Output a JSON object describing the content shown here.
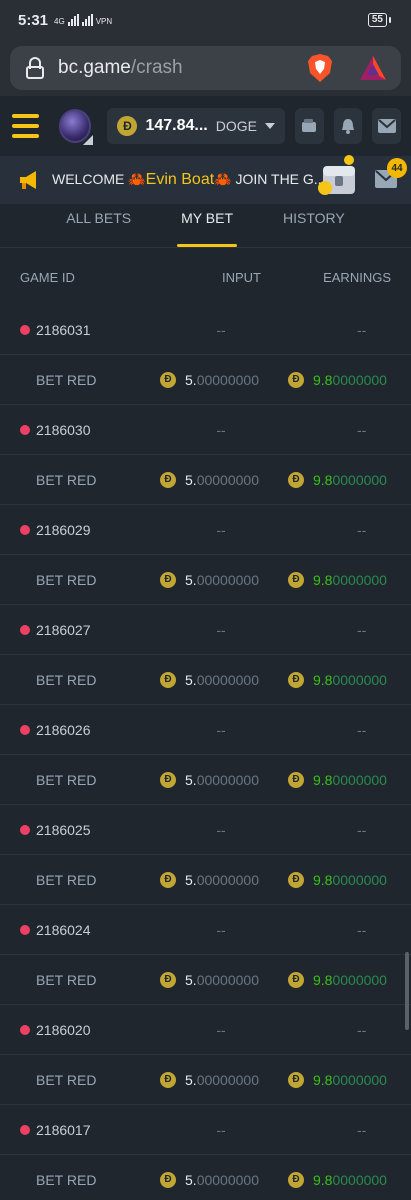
{
  "status": {
    "time": "5:31",
    "battery": "55",
    "net_labels": [
      "4G",
      "VPN"
    ]
  },
  "browser": {
    "domain": "bc.game",
    "path": "/crash"
  },
  "header": {
    "balance": "147.84...",
    "currency": "DOGE"
  },
  "ticker": {
    "prefix": "WELCOME",
    "name": "Evin Boat",
    "suffix": "JOIN THE G...",
    "crab": "🦀",
    "mail_badge": "44"
  },
  "tabs": [
    {
      "label": "ALL BETS",
      "active": false
    },
    {
      "label": "MY BET",
      "active": true
    },
    {
      "label": "HISTORY",
      "active": false
    }
  ],
  "table": {
    "headers": {
      "game_id": "GAME ID",
      "input": "INPUT",
      "earnings": "EARNINGS"
    },
    "placeholder": "--",
    "bet_label": "BET RED",
    "input_whole": "5.",
    "input_frac": "00000000",
    "earn_whole": "9.8",
    "earn_frac": "0000000",
    "coin_symbol": "Đ",
    "games": [
      "2186031",
      "2186030",
      "2186029",
      "2186027",
      "2186026",
      "2186025",
      "2186024",
      "2186020",
      "2186017"
    ]
  },
  "colors": {
    "accent": "#f5c518",
    "red_dot": "#ed4163",
    "win_green": "#3bc117",
    "bg": "#1f262e"
  }
}
